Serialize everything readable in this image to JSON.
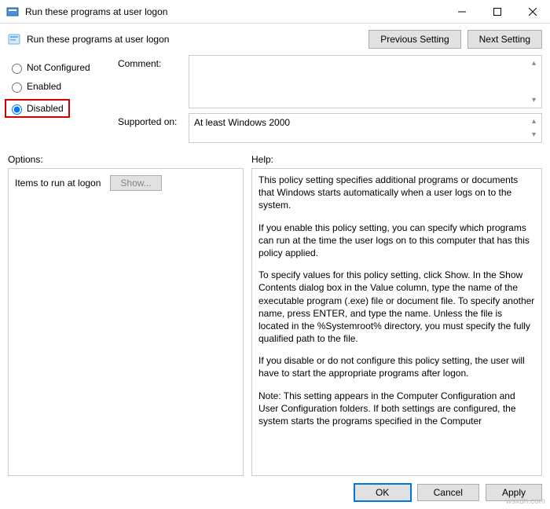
{
  "window": {
    "title": "Run these programs at user logon"
  },
  "header": {
    "title": "Run these programs at user logon",
    "prev_btn": "Previous Setting",
    "next_btn": "Next Setting"
  },
  "radios": {
    "not_configured": "Not Configured",
    "enabled": "Enabled",
    "disabled": "Disabled",
    "selected": "disabled"
  },
  "fields": {
    "comment_label": "Comment:",
    "comment_value": "",
    "supported_label": "Supported on:",
    "supported_value": "At least Windows 2000"
  },
  "lower": {
    "options_label": "Options:",
    "help_label": "Help:"
  },
  "options": {
    "items_label": "Items to run at logon",
    "show_btn": "Show..."
  },
  "help": {
    "p1": "This policy setting specifies additional programs or documents that Windows starts automatically when a user logs on to the system.",
    "p2": "If you enable this policy setting, you can specify which programs can run at the time the user logs on to this computer that has this policy applied.",
    "p3": "To specify values for this policy setting, click Show. In the Show Contents dialog box in the Value column, type the name of the executable program (.exe) file or document file. To specify another name, press ENTER, and type the name. Unless the file is located in the %Systemroot% directory, you must specify the fully qualified path to the file.",
    "p4": "If you disable or do not configure this policy setting, the user will have to start the appropriate programs after logon.",
    "p5": "Note: This setting appears in the Computer Configuration and User Configuration folders. If both settings are configured, the system starts the programs specified in the Computer"
  },
  "buttons": {
    "ok": "OK",
    "cancel": "Cancel",
    "apply": "Apply"
  },
  "watermark": "wsxdn.com"
}
